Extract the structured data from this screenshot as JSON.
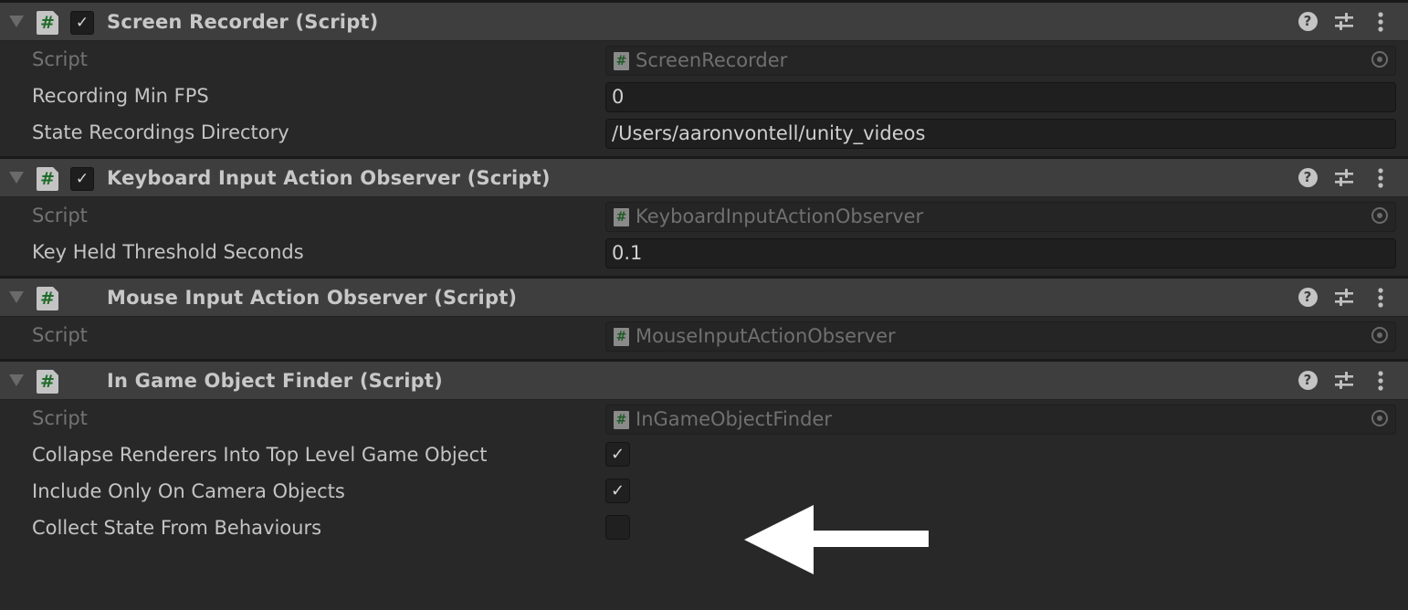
{
  "components": [
    {
      "title": "Screen Recorder (Script)",
      "enabled": true,
      "has_toggle": true,
      "fields": [
        {
          "label": "Script",
          "type": "object",
          "value": "ScreenRecorder",
          "disabled": true
        },
        {
          "label": "Recording Min FPS",
          "type": "text",
          "value": "0"
        },
        {
          "label": "State Recordings Directory",
          "type": "text",
          "value": "/Users/aaronvontell/unity_videos"
        }
      ]
    },
    {
      "title": "Keyboard Input Action Observer (Script)",
      "enabled": true,
      "has_toggle": true,
      "fields": [
        {
          "label": "Script",
          "type": "object",
          "value": "KeyboardInputActionObserver",
          "disabled": true
        },
        {
          "label": "Key Held Threshold Seconds",
          "type": "text",
          "value": "0.1"
        }
      ]
    },
    {
      "title": "Mouse Input Action Observer (Script)",
      "has_toggle": false,
      "fields": [
        {
          "label": "Script",
          "type": "object",
          "value": "MouseInputActionObserver",
          "disabled": true
        }
      ]
    },
    {
      "title": "In Game Object Finder (Script)",
      "has_toggle": false,
      "fields": [
        {
          "label": "Script",
          "type": "object",
          "value": "InGameObjectFinder",
          "disabled": true
        },
        {
          "label": "Collapse Renderers Into Top Level Game Object",
          "type": "checkbox",
          "checked": true
        },
        {
          "label": "Include Only On Camera Objects",
          "type": "checkbox",
          "checked": true
        },
        {
          "label": "Collect State From Behaviours",
          "type": "checkbox",
          "checked": false
        }
      ]
    }
  ],
  "icons": {
    "file": "#",
    "check": "✓",
    "help": "?",
    "presets": "sliders",
    "menu": "⋮"
  },
  "annotation": {
    "type": "arrow",
    "direction": "left",
    "color": "#ffffff"
  }
}
